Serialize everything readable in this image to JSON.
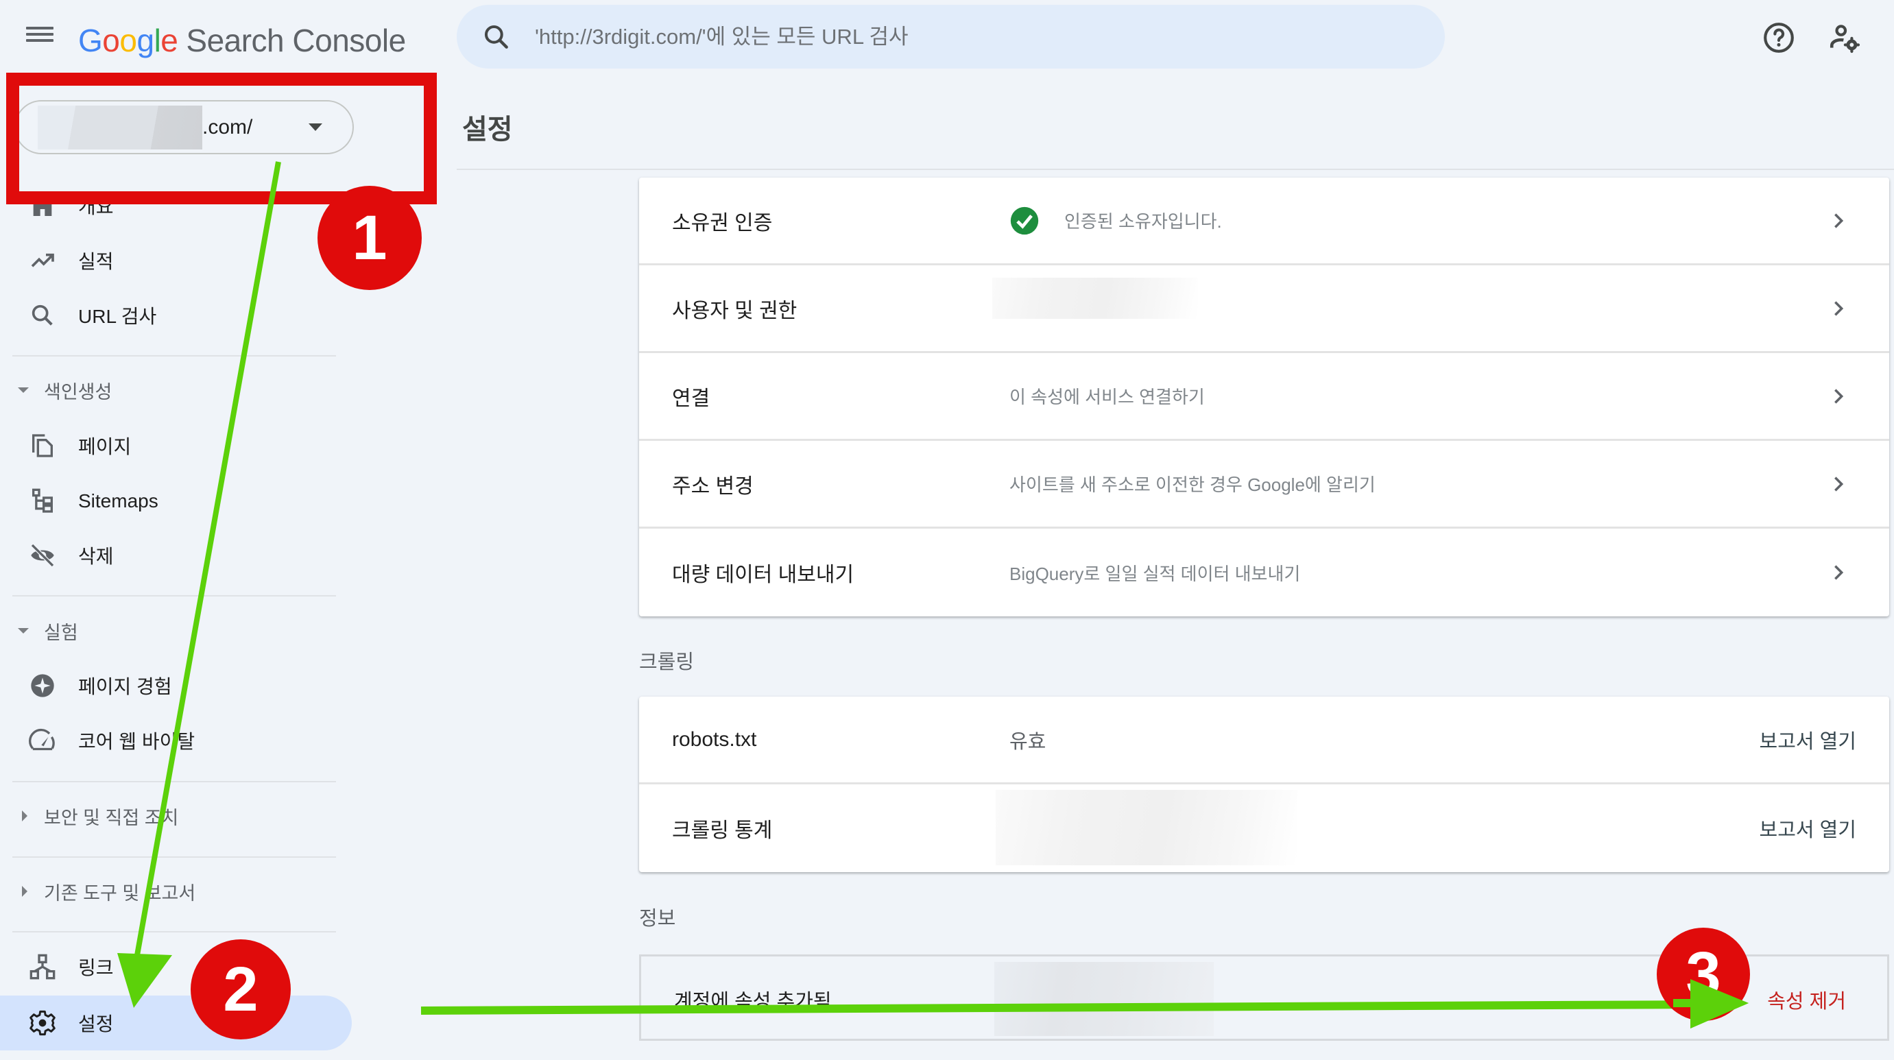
{
  "header": {
    "logo_google": [
      "G",
      "o",
      "o",
      "g",
      "l",
      "e"
    ],
    "logo_product": "Search Console",
    "search_placeholder": "'http://3rdigit.com/'에 있는 모든 URL 검사",
    "icons": {
      "menu": "hamburger-menu-icon",
      "search": "search-icon",
      "help": "help-circle-icon",
      "account": "manage-accounts-icon"
    }
  },
  "property": {
    "domain_suffix": ".com/",
    "domain_redacted": true
  },
  "sidebar": {
    "items_top": [
      {
        "label": "개요",
        "icon": "home-icon"
      },
      {
        "label": "실적",
        "icon": "trending-up-icon"
      },
      {
        "label": "URL 검사",
        "icon": "search-icon"
      }
    ],
    "indexing": {
      "label": "색인생성",
      "expanded": true,
      "items": [
        {
          "label": "페이지",
          "icon": "pages-icon"
        },
        {
          "label": "Sitemaps",
          "icon": "sitemap-icon"
        },
        {
          "label": "삭제",
          "icon": "visibility-off-icon"
        }
      ]
    },
    "experience": {
      "label": "실험",
      "expanded": true,
      "items": [
        {
          "label": "페이지 경험",
          "icon": "page-experience-icon"
        },
        {
          "label": "코어 웹 바이탈",
          "icon": "speed-gauge-icon"
        }
      ]
    },
    "security": {
      "label": "보안 및 직접 조치",
      "expanded": false
    },
    "legacy": {
      "label": "기존 도구 및 보고서",
      "expanded": false
    },
    "items_bottom": [
      {
        "label": "링크",
        "icon": "links-icon"
      },
      {
        "label": "설정",
        "icon": "settings-gear-icon",
        "active": true
      }
    ]
  },
  "main": {
    "title": "설정",
    "general_rows": [
      {
        "label": "소유권 인증",
        "value": "인증된 소유자입니다.",
        "status": "verified",
        "status_color": "#1e8e3e"
      },
      {
        "label": "사용자 및 권한",
        "value": null,
        "redacted": true
      },
      {
        "label": "연결",
        "value": "이 속성에 서비스 연결하기"
      },
      {
        "label": "주소 변경",
        "value": "사이트를 새 주소로 이전한 경우 Google에 알리기"
      },
      {
        "label": "대량 데이터 내보내기",
        "value": "BigQuery로 일일 실적 데이터 내보내기"
      }
    ],
    "crawling": {
      "heading": "크롤링",
      "rows": [
        {
          "label": "robots.txt",
          "value": "유효",
          "link": "보고서 열기"
        },
        {
          "label": "크롤링 통계",
          "value": null,
          "redacted": true,
          "link": "보고서 열기"
        }
      ]
    },
    "info": {
      "heading": "정보",
      "label": "계정에 속성 추가됨",
      "redacted": true,
      "remove_label": "속성 제거",
      "remove_color": "#c5221f"
    }
  },
  "annotations": {
    "badges": [
      "1",
      "2",
      "3"
    ],
    "badge_color": "#e00b0b",
    "arrow_color": "#5cd10a"
  }
}
